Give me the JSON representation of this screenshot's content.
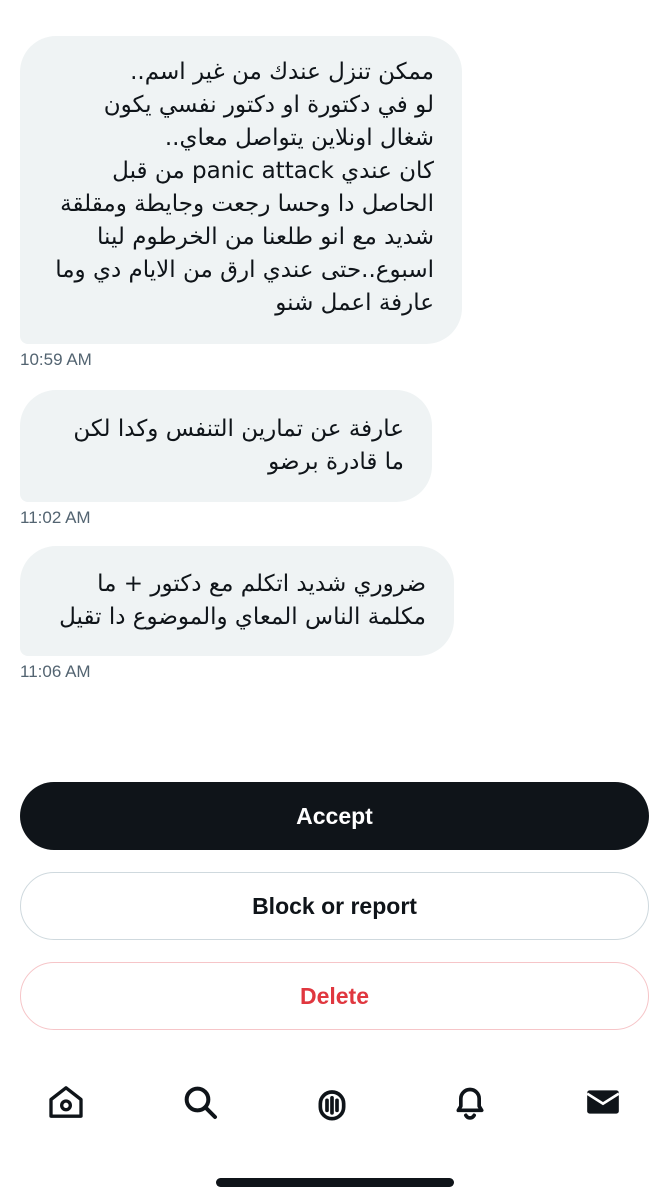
{
  "messages": [
    {
      "text": "ممكن تنزل عندك من غير اسم..\n لو في دكتورة او دكتور نفسي يكون شغال اونلاين يتواصل معاي..\nكان عندي panic attack  من قبل الحاصل دا وحسا رجعت وجايطة ومقلقة شديد مع انو طلعنا من الخرطوم لينا اسبوع..حتى عندي ارق من الايام دي وما عارفة اعمل شنو",
      "time": "10:59 AM"
    },
    {
      "text": "عارفة عن تمارين التنفس وكدا لكن ما قادرة برضو",
      "time": "11:02 AM"
    },
    {
      "text": "ضروري شديد اتكلم مع دكتور + ما مكلمة الناس المعاي والموضوع دا تقيل",
      "time": "11:06 AM"
    }
  ],
  "actions": {
    "accept_label": "Accept",
    "block_label": "Block or report",
    "delete_label": "Delete"
  },
  "tabbar": {
    "items": [
      {
        "icon": "home-icon"
      },
      {
        "icon": "search-icon"
      },
      {
        "icon": "spaces-icon"
      },
      {
        "icon": "bell-icon"
      },
      {
        "icon": "envelope-icon"
      }
    ]
  },
  "colors": {
    "bubble": "#eff3f4",
    "accept_bg": "#0f1419",
    "delete_text": "#e0373f",
    "timestamp": "#536471"
  }
}
